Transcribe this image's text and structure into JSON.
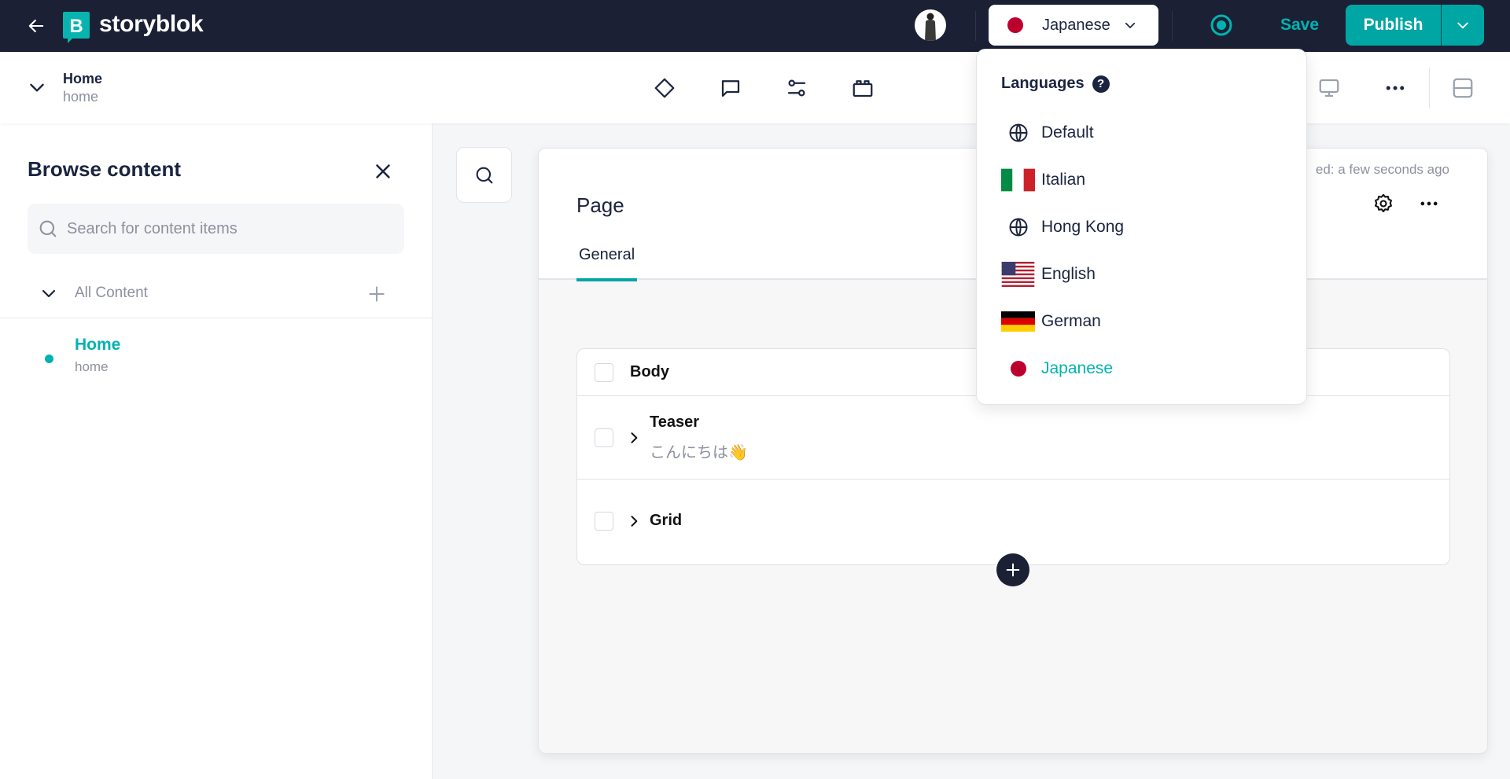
{
  "topbar": {
    "brand": "storyblok",
    "language_button": "Japanese",
    "save_label": "Save",
    "publish_label": "Publish"
  },
  "story": {
    "name": "Home",
    "slug": "home"
  },
  "toolbar_icons": [
    "diamond-icon",
    "comment-icon",
    "settings-sliders-icon",
    "blocks-icon",
    "monitor-icon",
    "more-icon",
    "layout-icon"
  ],
  "left_panel": {
    "title": "Browse content",
    "search_placeholder": "Search for content items",
    "folder_label": "All Content",
    "items": [
      {
        "name": "Home",
        "slug": "home"
      }
    ]
  },
  "card": {
    "saved_text": "ed: a few seconds ago",
    "title": "Page",
    "tabs": [
      {
        "label": "General",
        "active": true
      }
    ],
    "blocks_field": "Body",
    "blocks": [
      {
        "name": "Teaser",
        "preview": "こんにちは👋"
      },
      {
        "name": "Grid",
        "preview": ""
      }
    ]
  },
  "languages_dropdown": {
    "title": "Languages",
    "help_glyph": "?",
    "selected": "Japanese",
    "items": [
      {
        "label": "Default",
        "icon": "globe"
      },
      {
        "label": "Italian",
        "icon": "flag-it"
      },
      {
        "label": "Hong Kong",
        "icon": "globe"
      },
      {
        "label": "English",
        "icon": "flag-us"
      },
      {
        "label": "German",
        "icon": "flag-de"
      },
      {
        "label": "Japanese",
        "icon": "flag-jp"
      }
    ]
  },
  "colors": {
    "topbar": "#1b2035",
    "accent": "#00a6a3",
    "accent_text": "#00b3b0",
    "japan_red": "#bc002d"
  }
}
